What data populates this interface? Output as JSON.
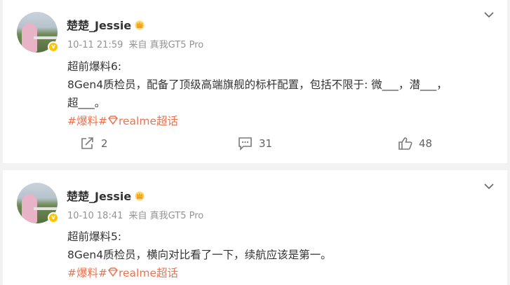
{
  "posts": [
    {
      "username": "楚楚_Jessie",
      "timestamp": "10-11 21:59",
      "source": "来自 真我GT5 Pro",
      "lines": [
        "超前爆料6:",
        "8Gen4质检员，配备了顶级高端旗舰的标杆配置，包括不限于: 微___，潜___，",
        "超___。"
      ],
      "tags": [
        "#爆料#",
        "realme超话"
      ],
      "reposts": "2",
      "comments": "31",
      "likes": "48"
    },
    {
      "username": "楚楚_Jessie",
      "timestamp": "10-10 18:41",
      "source": "来自 真我GT5 Pro",
      "lines": [
        "超前爆料5:",
        "8Gen4质检员，横向对比看了一下，续航应该是第一。"
      ],
      "tags": [
        "#爆料#",
        "realme超话"
      ]
    }
  ],
  "colors": {
    "accent_tag": "#eb7350",
    "verified_badge": "#ffc400",
    "meta_gray": "#939393"
  },
  "icons": {
    "verified": "verified-badge-icon",
    "crown": "crown-icon",
    "more": "chevron-down-icon",
    "supertopic": "diamond-icon",
    "repost": "repost-icon",
    "comment": "comment-icon",
    "like": "like-icon"
  }
}
